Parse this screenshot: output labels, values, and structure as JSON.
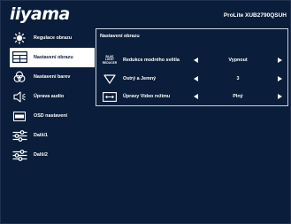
{
  "header": {
    "brand": "iiyama",
    "model": "ProLite XUB2790QSUH"
  },
  "sidebar": {
    "items": [
      {
        "label": "Regulace obrazu",
        "icon": "brightness-icon",
        "active": false
      },
      {
        "label": "Nastavení obrazu",
        "icon": "display-settings-icon",
        "active": true
      },
      {
        "label": "Nastavení barev",
        "icon": "color-settings-icon",
        "active": false
      },
      {
        "label": "Úprava audio",
        "icon": "speaker-icon",
        "active": false
      },
      {
        "label": "OSD nastavení",
        "icon": "osd-icon",
        "active": false
      },
      {
        "label": "Další1",
        "icon": "sliders-icon",
        "active": false
      },
      {
        "label": "Další2",
        "icon": "sliders-icon",
        "active": false
      }
    ]
  },
  "panel": {
    "title": "Nastavení obrazu",
    "rows": [
      {
        "icon": "blue-light-icon",
        "icon_text": [
          "BLUE",
          "LIGHT",
          "REDUCER"
        ],
        "label": "Redukce modrého světla",
        "value": "Vypnout"
      },
      {
        "icon": "triangle-down-icon",
        "label": "Ostrý a Jemný",
        "value": "3"
      },
      {
        "icon": "video-mode-icon",
        "label": "Úpravy Video režimu",
        "value": "Plný"
      }
    ]
  },
  "colors": {
    "background": "#0a1d3a",
    "text": "#ffffff",
    "active_background": "#ffffff",
    "active_text": "#0a1d3a",
    "panel_border": "#c9d1dc"
  }
}
